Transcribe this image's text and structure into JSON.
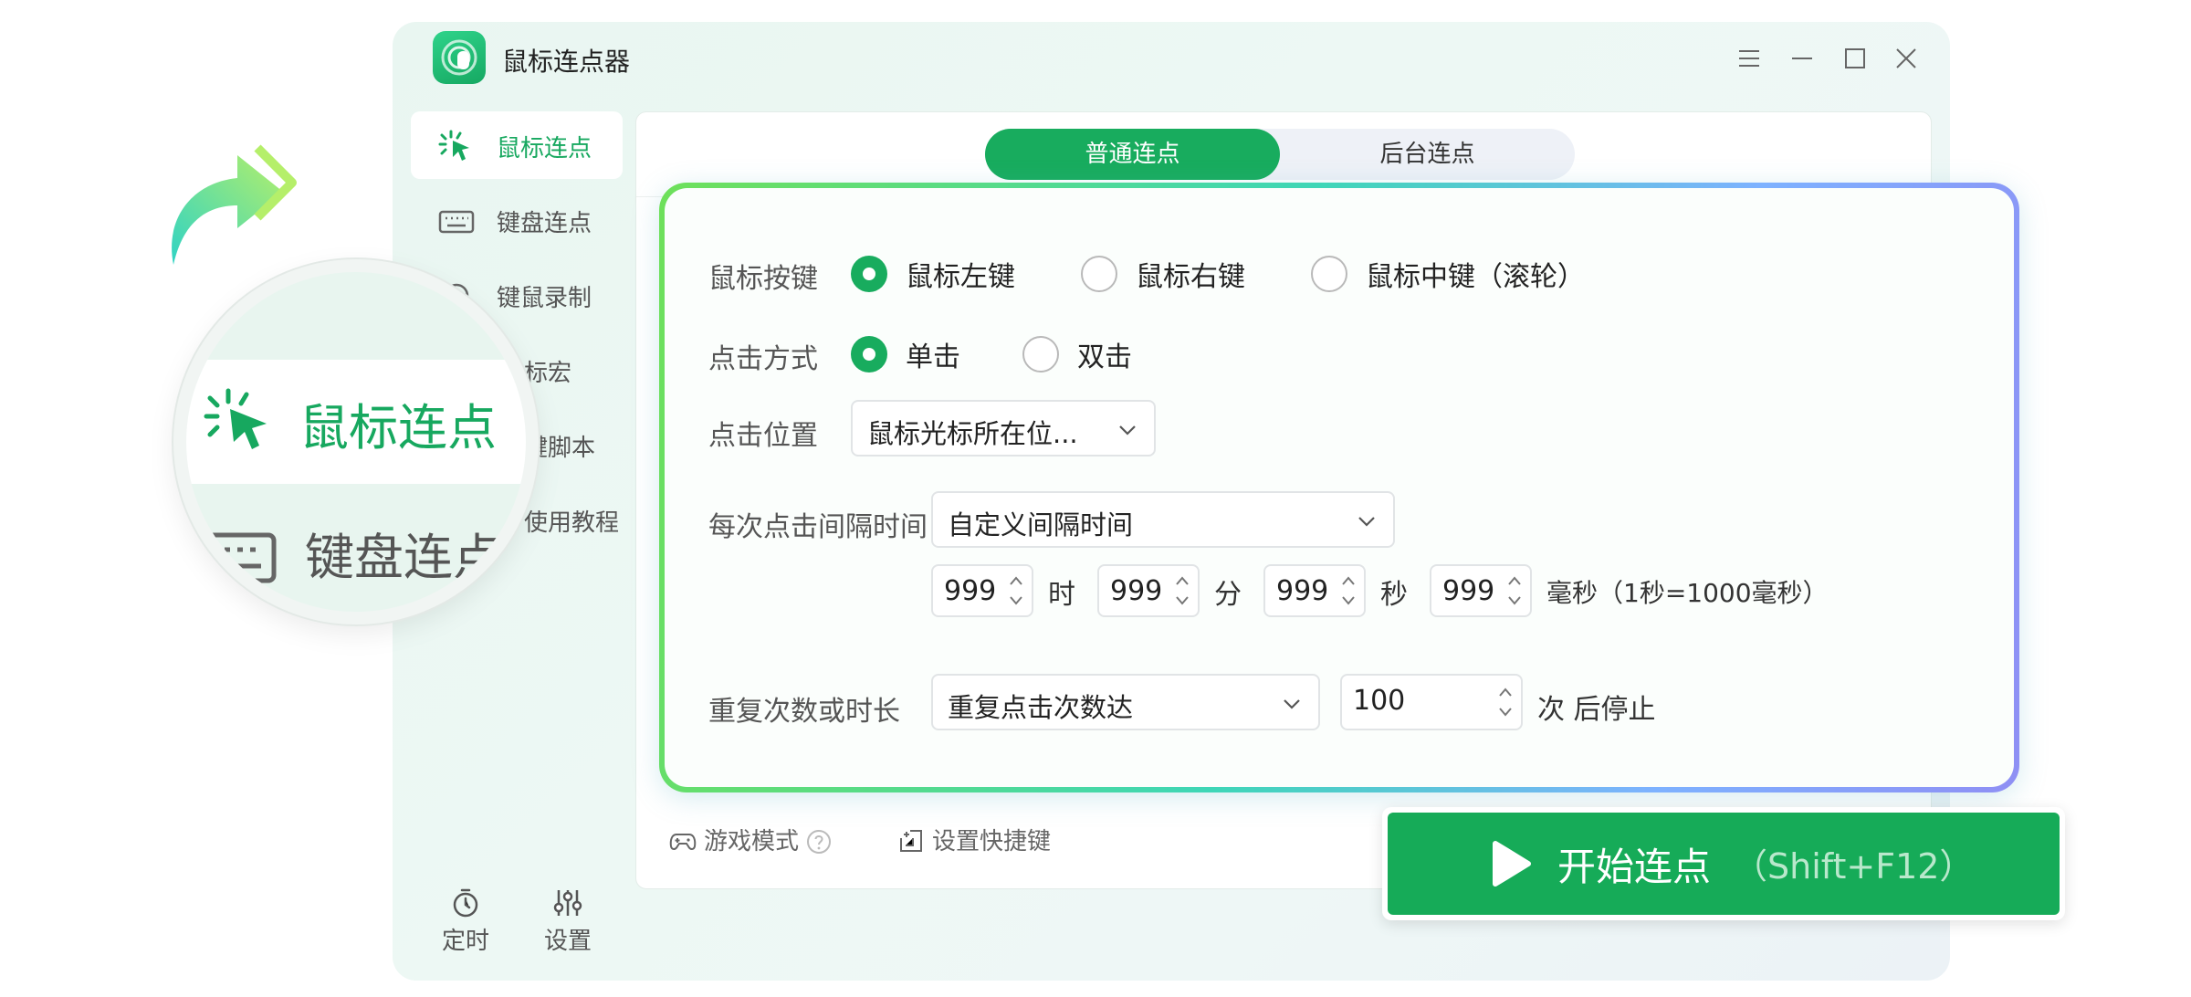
{
  "window": {
    "title": "鼠标连点器"
  },
  "sidebar": {
    "items": [
      {
        "label": "鼠标连点",
        "icon": "cursor-click-icon",
        "active": true
      },
      {
        "label": "键盘连点",
        "icon": "keyboard-icon",
        "active": false
      },
      {
        "label": "键鼠录制",
        "icon": "record-icon",
        "active": false
      },
      {
        "label": "标宏",
        "icon": "macro-icon",
        "active": false
      },
      {
        "label": "键脚本",
        "icon": "script-icon",
        "active": false
      },
      {
        "label": "使用教程",
        "icon": "tutorial-icon",
        "active": false
      }
    ],
    "bottom": [
      {
        "label": "定时",
        "icon": "timer-icon"
      },
      {
        "label": "设置",
        "icon": "sliders-icon"
      }
    ]
  },
  "tabs": [
    {
      "label": "普通连点",
      "active": true
    },
    {
      "label": "后台连点",
      "active": false
    }
  ],
  "form": {
    "mouse_button": {
      "label": "鼠标按键",
      "options": [
        "鼠标左键",
        "鼠标右键",
        "鼠标中键（滚轮）"
      ],
      "selected": "鼠标左键"
    },
    "click_type": {
      "label": "点击方式",
      "options": [
        "单击",
        "双击"
      ],
      "selected": "单击"
    },
    "click_position": {
      "label": "点击位置",
      "value": "鼠标光标所在位..."
    },
    "interval": {
      "label": "每次点击间隔时间",
      "mode": "自定义间隔时间",
      "hours": "999",
      "hours_unit": "时",
      "minutes": "999",
      "minutes_unit": "分",
      "seconds": "999",
      "seconds_unit": "秒",
      "ms": "999",
      "ms_unit": "毫秒（1秒=1000毫秒）"
    },
    "repeat": {
      "label": "重复次数或时长",
      "mode": "重复点击次数达",
      "count": "100",
      "suffix": "次 后停止"
    }
  },
  "footer": {
    "game_mode": "游戏模式",
    "shortcut": "设置快捷键"
  },
  "start_button": {
    "label": "开始连点",
    "hotkey": "（Shift+F12）"
  },
  "magnifier": {
    "active_label": "鼠标连点",
    "next_label": "键盘连点"
  },
  "colors": {
    "accent": "#18ac5e",
    "start_button": "#16ab58"
  }
}
